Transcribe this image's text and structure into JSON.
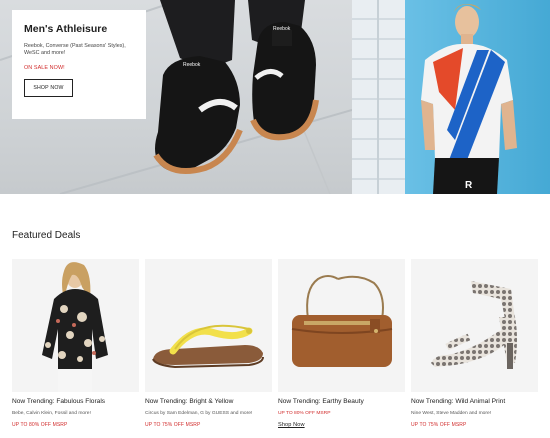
{
  "hero": {
    "title": "Men's Athleisure",
    "description": "Reebok, Converse (Past Seasons' Styles), WeSC and more!",
    "sale_label": "ON SALE NOW!",
    "button_label": "SHOP NOW",
    "shoe_brand": "Reebok",
    "shirt_text": "R"
  },
  "featured": {
    "title": "Featured Deals",
    "deals": [
      {
        "title": "Now Trending: Fabulous Florals",
        "subtitle": "Bebe, Calvin Klein, Fossil and more!",
        "cta": "UP TO 80% OFF MSRP"
      },
      {
        "title": "Now Trending: Bright & Yellow",
        "subtitle": "Circus by Sam Edelman, G by GUESS and more!",
        "cta": "UP TO 75% OFF MSRP"
      },
      {
        "title": "Now Trending: Earthy Beauty",
        "subtitle": "UP TO 80% OFF MSRP",
        "cta": "Shop Now"
      },
      {
        "title": "Now Trending: Wild Animal Print",
        "subtitle": "Nine West, Steve Madden and more!",
        "cta": "UP TO 75% OFF MSRP"
      }
    ]
  },
  "colors": {
    "sale_red": "#d12c2c",
    "wall_blue": "#49b2e0"
  },
  "icons": [
    "sneaker-image",
    "model-image",
    "blouse-image",
    "sandal-image",
    "handbag-image",
    "heel-image"
  ]
}
